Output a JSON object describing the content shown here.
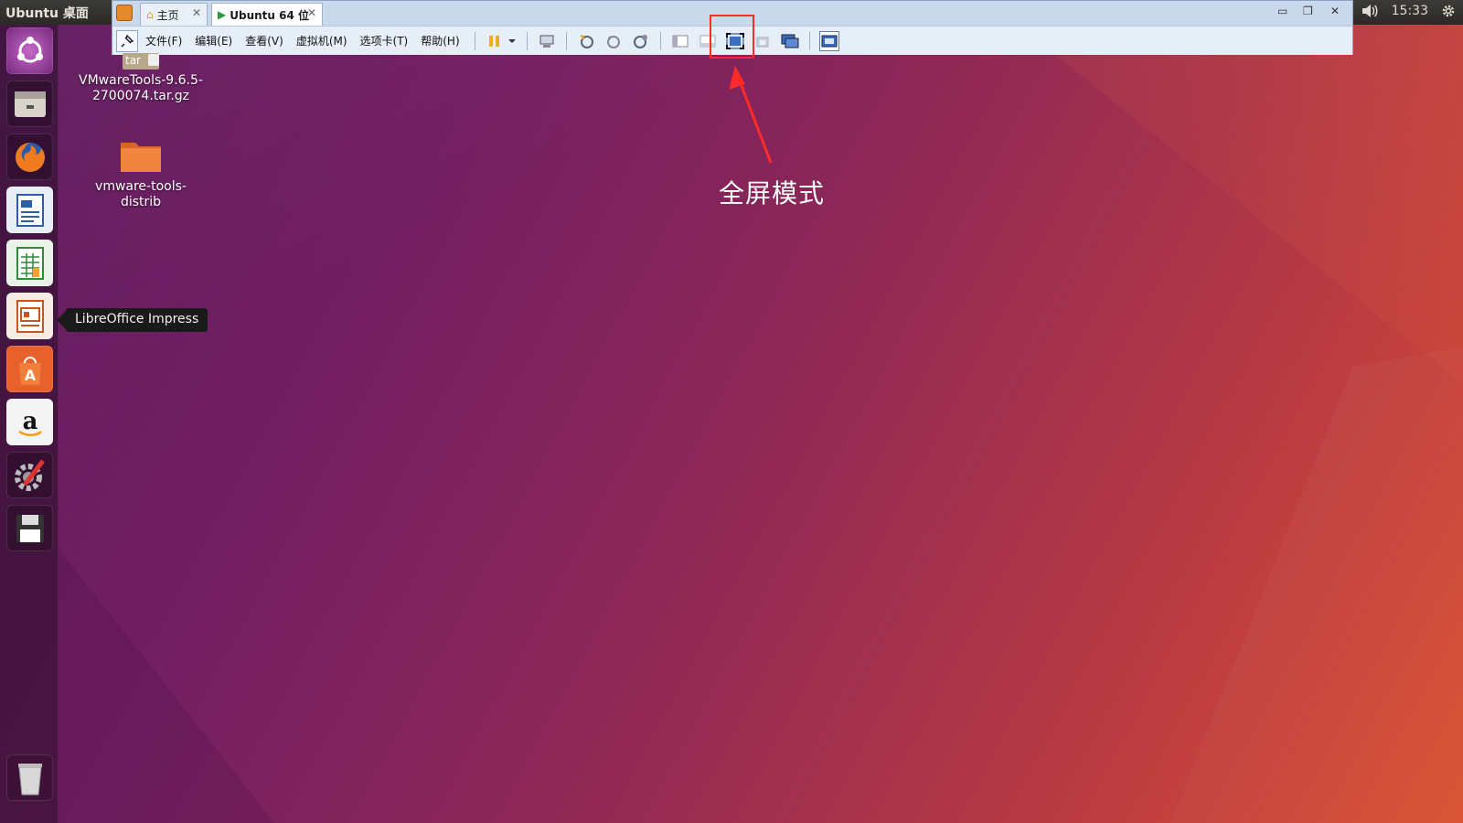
{
  "top_panel": {
    "title": "Ubuntu 桌面",
    "time": "15:33"
  },
  "launcher": {
    "tooltip": "LibreOffice Impress",
    "items": [
      {
        "name": "ubuntu-dash-icon"
      },
      {
        "name": "files-icon"
      },
      {
        "name": "firefox-icon"
      },
      {
        "name": "writer-icon"
      },
      {
        "name": "calc-icon"
      },
      {
        "name": "impress-icon"
      },
      {
        "name": "software-center-icon"
      },
      {
        "name": "amazon-icon"
      },
      {
        "name": "system-settings-icon"
      },
      {
        "name": "save-disk-icon"
      },
      {
        "name": "trash-icon"
      }
    ]
  },
  "vmware": {
    "tabs": [
      {
        "label": "主页"
      },
      {
        "label": "Ubuntu 64 位"
      }
    ],
    "menu": {
      "file": "文件(F)",
      "edit": "编辑(E)",
      "view": "查看(V)",
      "vm": "虚拟机(M)",
      "tabs": "选项卡(T)",
      "help": "帮助(H)"
    }
  },
  "desktop": {
    "archive_label": "VMwareTools-9.6.5-2700074.tar.gz",
    "archive_badge": "tar",
    "folder_label": "vmware-tools-distrib"
  },
  "annotation": {
    "label": "全屏模式",
    "color": "#ff2a2a"
  }
}
